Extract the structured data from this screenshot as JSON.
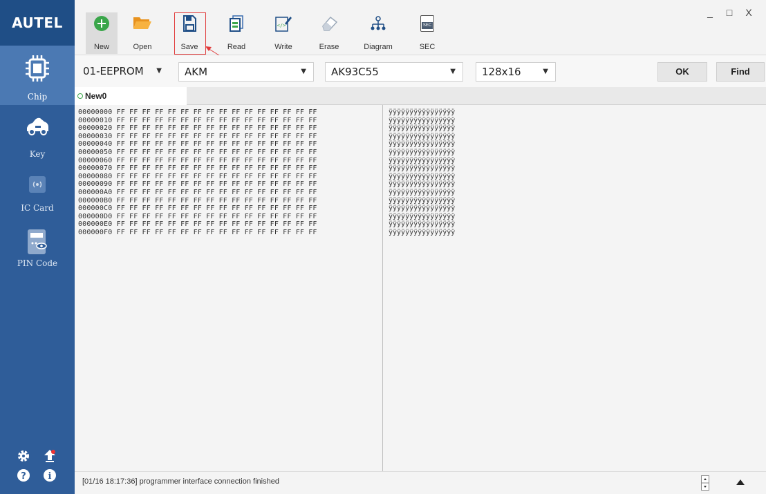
{
  "app": {
    "logo": "AUTEL"
  },
  "sidebar": {
    "items": [
      {
        "label": "Chip",
        "icon": "chip-icon"
      },
      {
        "label": "Key",
        "icon": "car-key-icon"
      },
      {
        "label": "IC Card",
        "icon": "ic-card-icon"
      },
      {
        "label": "PIN Code",
        "icon": "pin-code-icon"
      }
    ],
    "bottom_icons": [
      "settings-icon",
      "upload-icon",
      "help-icon",
      "info-icon"
    ]
  },
  "toolbar": {
    "new_label": "New",
    "open_label": "Open",
    "save_label": "Save",
    "read_label": "Read",
    "write_label": "Write",
    "erase_label": "Erase",
    "diagram_label": "Diagram",
    "sec_label": "SEC",
    "sec_icon_text": "SEC"
  },
  "window": {
    "minimize": "_",
    "maximize": "□",
    "close": "X"
  },
  "selectors": {
    "type": "01-EEPROM",
    "brand": "AKM",
    "model": "AK93C55",
    "size": "128x16",
    "ok_label": "OK",
    "find_label": "Find"
  },
  "tabs": [
    {
      "label": "New0"
    }
  ],
  "hex": {
    "lines": [
      "00000000 FF FF FF FF FF FF FF FF FF FF FF FF FF FF FF FF",
      "00000010 FF FF FF FF FF FF FF FF FF FF FF FF FF FF FF FF",
      "00000020 FF FF FF FF FF FF FF FF FF FF FF FF FF FF FF FF",
      "00000030 FF FF FF FF FF FF FF FF FF FF FF FF FF FF FF FF",
      "00000040 FF FF FF FF FF FF FF FF FF FF FF FF FF FF FF FF",
      "00000050 FF FF FF FF FF FF FF FF FF FF FF FF FF FF FF FF",
      "00000060 FF FF FF FF FF FF FF FF FF FF FF FF FF FF FF FF",
      "00000070 FF FF FF FF FF FF FF FF FF FF FF FF FF FF FF FF",
      "00000080 FF FF FF FF FF FF FF FF FF FF FF FF FF FF FF FF",
      "00000090 FF FF FF FF FF FF FF FF FF FF FF FF FF FF FF FF",
      "000000A0 FF FF FF FF FF FF FF FF FF FF FF FF FF FF FF FF",
      "000000B0 FF FF FF FF FF FF FF FF FF FF FF FF FF FF FF FF",
      "000000C0 FF FF FF FF FF FF FF FF FF FF FF FF FF FF FF FF",
      "000000D0 FF FF FF FF FF FF FF FF FF FF FF FF FF FF FF FF",
      "000000E0 FF FF FF FF FF FF FF FF FF FF FF FF FF FF FF FF",
      "000000F0 FF FF FF FF FF FF FF FF FF FF FF FF FF FF FF FF"
    ],
    "ascii": [
      "ÿÿÿÿÿÿÿÿÿÿÿÿÿÿÿÿ",
      "ÿÿÿÿÿÿÿÿÿÿÿÿÿÿÿÿ",
      "ÿÿÿÿÿÿÿÿÿÿÿÿÿÿÿÿ",
      "ÿÿÿÿÿÿÿÿÿÿÿÿÿÿÿÿ",
      "ÿÿÿÿÿÿÿÿÿÿÿÿÿÿÿÿ",
      "ÿÿÿÿÿÿÿÿÿÿÿÿÿÿÿÿ",
      "ÿÿÿÿÿÿÿÿÿÿÿÿÿÿÿÿ",
      "ÿÿÿÿÿÿÿÿÿÿÿÿÿÿÿÿ",
      "ÿÿÿÿÿÿÿÿÿÿÿÿÿÿÿÿ",
      "ÿÿÿÿÿÿÿÿÿÿÿÿÿÿÿÿ",
      "ÿÿÿÿÿÿÿÿÿÿÿÿÿÿÿÿ",
      "ÿÿÿÿÿÿÿÿÿÿÿÿÿÿÿÿ",
      "ÿÿÿÿÿÿÿÿÿÿÿÿÿÿÿÿ",
      "ÿÿÿÿÿÿÿÿÿÿÿÿÿÿÿÿ",
      "ÿÿÿÿÿÿÿÿÿÿÿÿÿÿÿÿ",
      "ÿÿÿÿÿÿÿÿÿÿÿÿÿÿÿÿ"
    ]
  },
  "status": {
    "message": "[01/16 18:17:36] programmer interface connection finished"
  },
  "colors": {
    "sidebar": "#2f5d99",
    "sidebar_active": "#4b79b3",
    "logo_bg": "#1f4e86",
    "new_green": "#3aa64a",
    "open_orange": "#f0a030",
    "highlight_red": "#e13b3b"
  }
}
